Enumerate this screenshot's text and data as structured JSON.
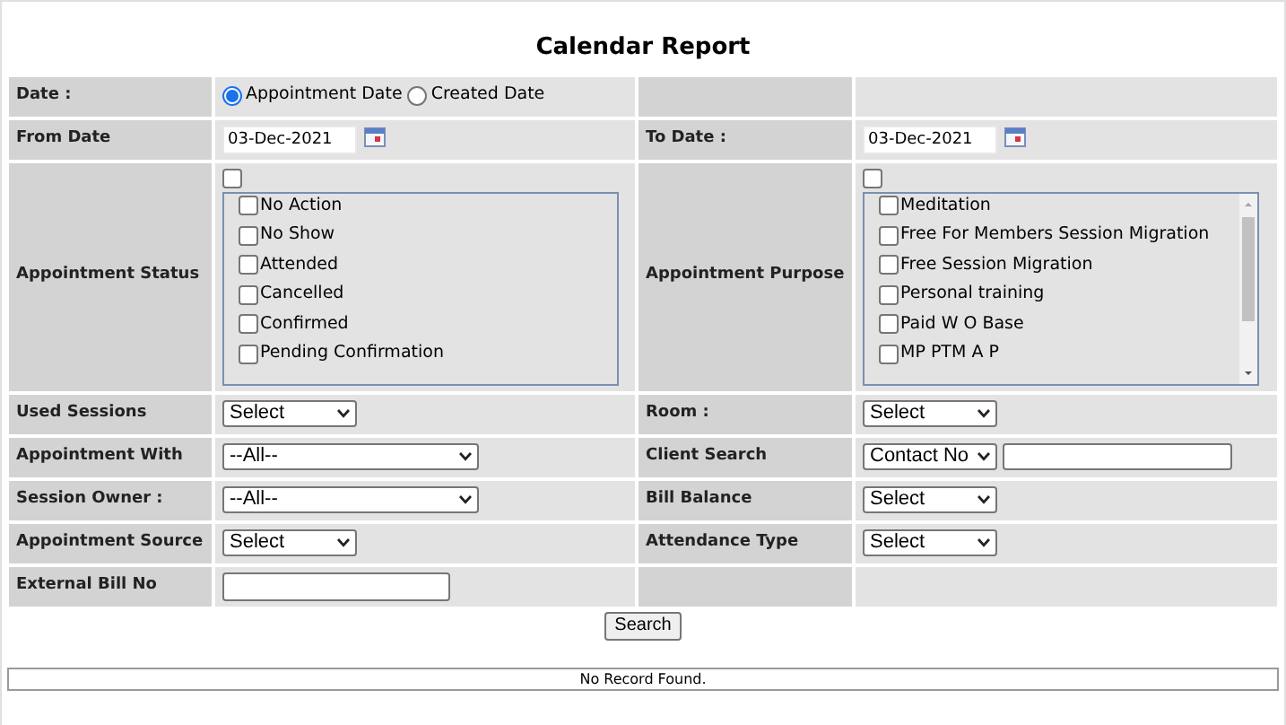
{
  "title": "Calendar Report",
  "rows": [
    {
      "left": {
        "label": "Date :",
        "field": {
          "kind": "radio",
          "options": [
            {
              "label": "Appointment Date",
              "selected": true
            },
            {
              "label": "Created Date",
              "selected": false
            }
          ]
        }
      },
      "right": {
        "field": {
          "kind": "empty"
        }
      }
    },
    {
      "left": {
        "label": "From Date",
        "field": {
          "kind": "date",
          "value": "03-Dec-2021"
        }
      },
      "right": {
        "label": "To Date :",
        "field": {
          "kind": "date",
          "value": "03-Dec-2021"
        }
      }
    },
    {
      "left": {
        "label": "Appointment Status",
        "field": {
          "kind": "checklist",
          "all_checked": false,
          "scroll": false,
          "items": [
            {
              "label": "No Action",
              "checked": false
            },
            {
              "label": "No Show",
              "checked": false
            },
            {
              "label": "Attended",
              "checked": false
            },
            {
              "label": "Cancelled",
              "checked": false
            },
            {
              "label": "Confirmed",
              "checked": false
            },
            {
              "label": "Pending Confirmation",
              "checked": false
            }
          ]
        }
      },
      "right": {
        "label": "Appointment Purpose",
        "field": {
          "kind": "checklist",
          "all_checked": false,
          "scroll": true,
          "items": [
            {
              "label": "Meditation",
              "checked": false
            },
            {
              "label": "Free For Members Session Migration",
              "checked": false
            },
            {
              "label": "Free Session Migration",
              "checked": false
            },
            {
              "label": "Personal training",
              "checked": false
            },
            {
              "label": "Paid W O Base",
              "checked": false
            },
            {
              "label": "MP PTM A P",
              "checked": false
            }
          ]
        }
      }
    },
    {
      "left": {
        "label": "Used Sessions",
        "field": {
          "kind": "select",
          "value": "Select",
          "wide": false
        }
      },
      "right": {
        "label": "Room :",
        "field": {
          "kind": "select",
          "value": "Select",
          "wide": false
        }
      }
    },
    {
      "left": {
        "label": "Appointment With",
        "field": {
          "kind": "select",
          "value": "--All--",
          "wide": true
        }
      },
      "right": {
        "label": "Client Search",
        "field": {
          "kind": "select_input",
          "value": "Contact No"
        }
      }
    },
    {
      "left": {
        "label": "Session Owner :",
        "field": {
          "kind": "select",
          "value": "--All--",
          "wide": true
        }
      },
      "right": {
        "label": "Bill Balance",
        "field": {
          "kind": "select",
          "value": "Select",
          "wide": false
        }
      }
    },
    {
      "left": {
        "label": "Appointment Source",
        "field": {
          "kind": "select",
          "value": "Select",
          "wide": false
        }
      },
      "right": {
        "label": "Attendance Type",
        "field": {
          "kind": "select",
          "value": "Select",
          "wide": false
        }
      }
    },
    {
      "left": {
        "label": "External Bill No",
        "field": {
          "kind": "input"
        }
      },
      "right": {
        "field": {
          "kind": "empty"
        }
      }
    }
  ],
  "search_button": "Search",
  "result_message": "No Record Found."
}
